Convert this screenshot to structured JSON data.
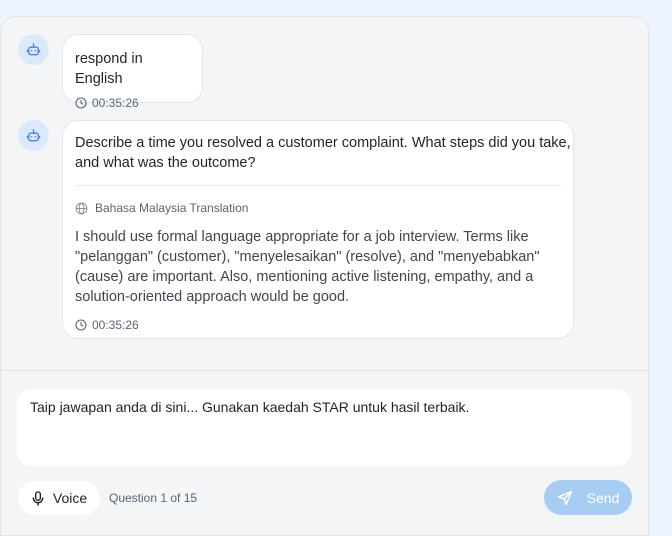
{
  "messages": [
    {
      "text": "respond in English",
      "time": "00:35:26"
    },
    {
      "text_line1": "Describe a time you resolved a customer complaint. What steps did you take,",
      "text_line2": "and what was the outcome?",
      "translation_label": "Bahasa Malaysia Translation",
      "translation_lines": [
        "I should use formal language appropriate for a job interview. Terms like",
        "\"pelanggan\" (customer), \"menyelesaikan\" (resolve), and \"menyebabkan\"",
        "(cause) are important. Also, mentioning active listening, empathy, and a",
        "solution-oriented approach would be good."
      ],
      "time": "00:35:26"
    }
  ],
  "composer": {
    "placeholder": "Taip jawapan anda di sini... Gunakan kaedah STAR untuk hasil terbaik.",
    "voice_label": "Voice",
    "question_counter": "Question 1 of 15",
    "send_label": "Send"
  },
  "icons": {
    "avatar": "robot-icon",
    "time": "clock-icon",
    "translation": "globe-icon",
    "voice": "microphone-icon",
    "send": "paper-plane-icon"
  },
  "colors": {
    "accent": "#4a86d8",
    "send_button": "#a8cdf3",
    "avatar_bg": "#dce8fb"
  }
}
